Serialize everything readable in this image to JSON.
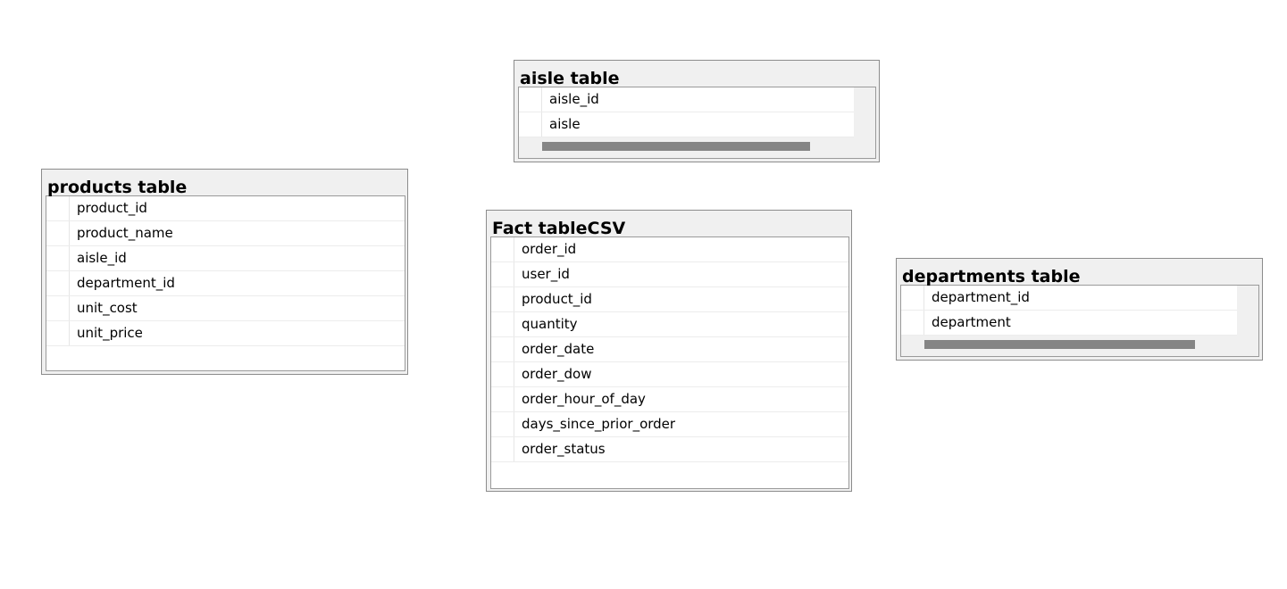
{
  "tables": {
    "aisle": {
      "title": "aisle table",
      "fields": [
        "aisle_id",
        "aisle"
      ]
    },
    "products": {
      "title": "products table",
      "fields": [
        "product_id",
        "product_name",
        "aisle_id",
        "department_id",
        "unit_cost",
        "unit_price"
      ]
    },
    "fact": {
      "title": "Fact tableCSV",
      "fields": [
        "order_id",
        "user_id",
        "product_id",
        "quantity",
        "order_date",
        "order_dow",
        "order_hour_of_day",
        "days_since_prior_order",
        "order_status"
      ]
    },
    "departments": {
      "title": "departments table",
      "fields": [
        "department_id",
        "department"
      ]
    }
  },
  "colors": {
    "card_background": "#f0f0f0",
    "card_border": "#8c8c8c",
    "scrollbar_thumb": "#858585",
    "canvas_background": "#ffffff"
  }
}
